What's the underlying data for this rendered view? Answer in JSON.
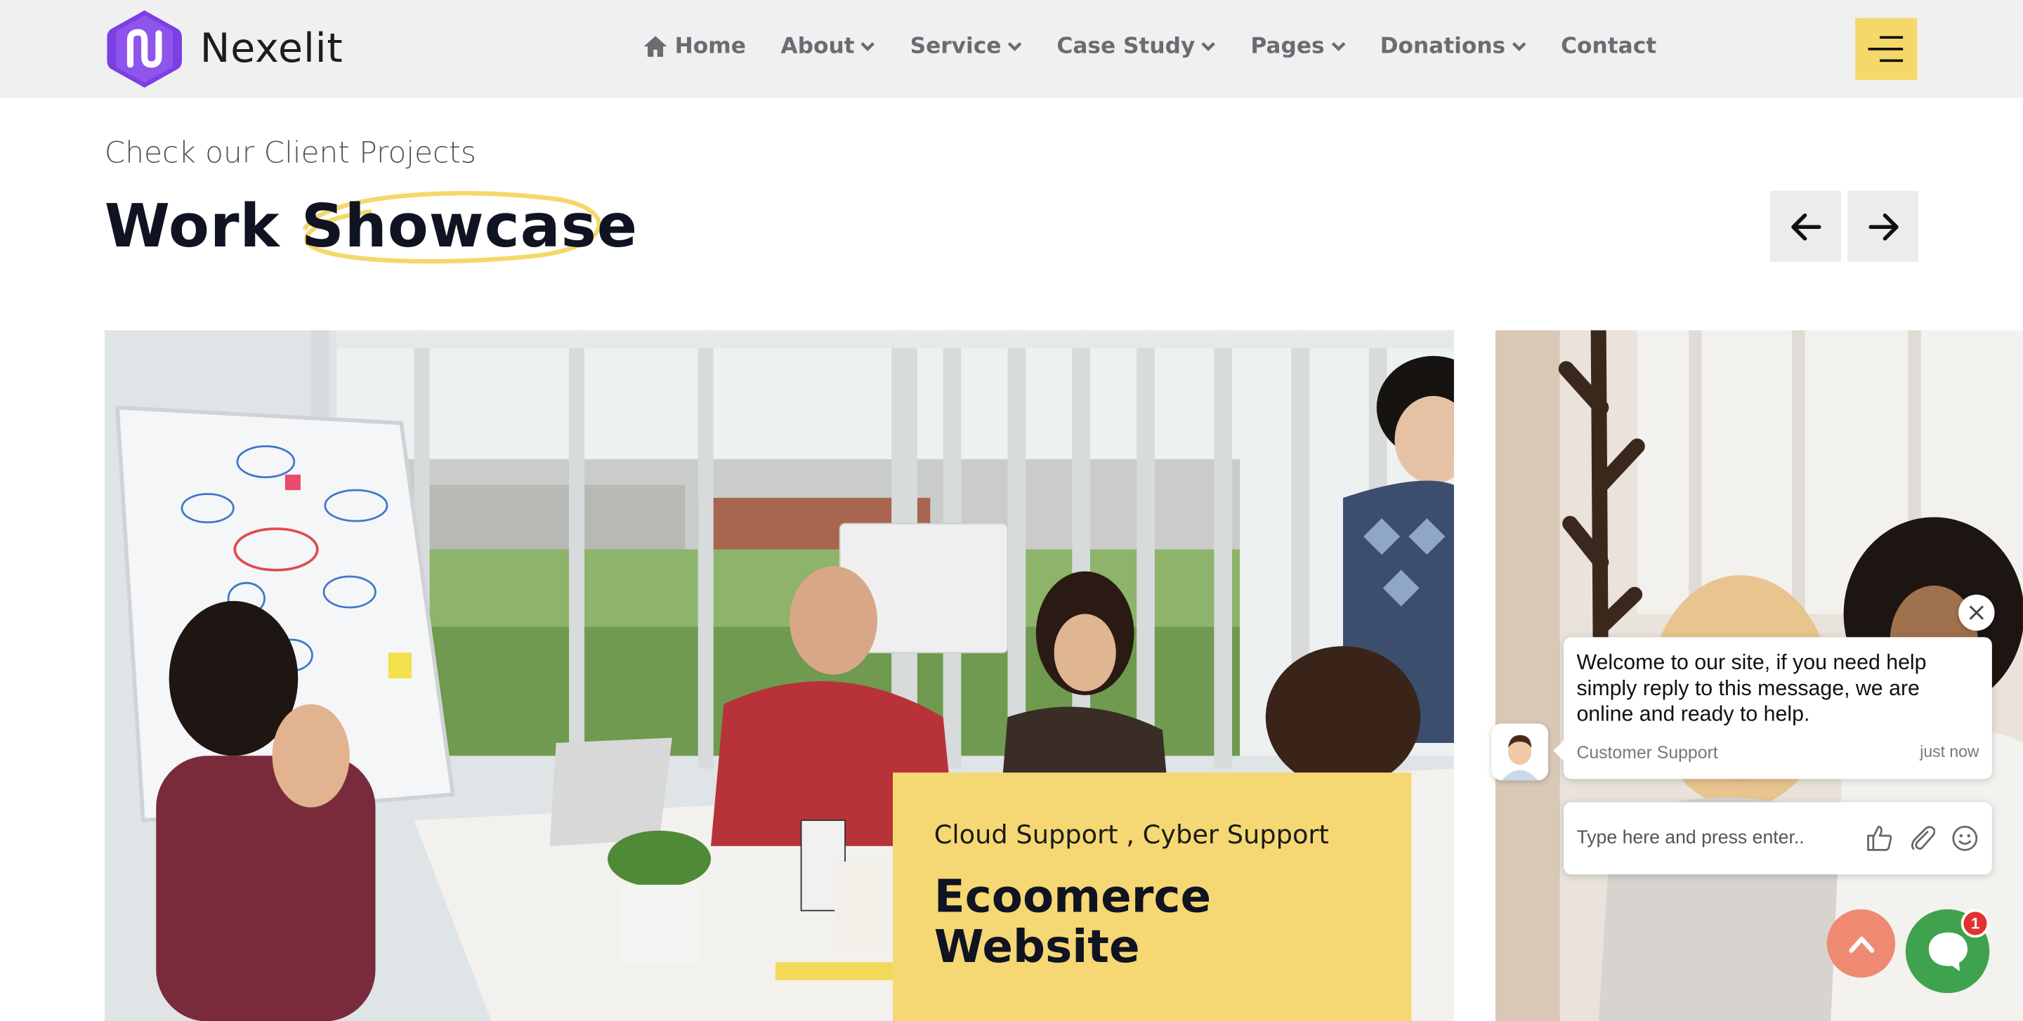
{
  "brand": {
    "name": "Nexelit",
    "logo_color": "#7b3fe4",
    "accent": "#f5d86a"
  },
  "nav": {
    "items": [
      {
        "label": "Home",
        "icon": "home-icon",
        "dropdown": false
      },
      {
        "label": "About",
        "dropdown": true
      },
      {
        "label": "Service",
        "dropdown": true
      },
      {
        "label": "Case Study",
        "dropdown": true
      },
      {
        "label": "Pages",
        "dropdown": true
      },
      {
        "label": "Donations",
        "dropdown": true
      },
      {
        "label": "Contact",
        "dropdown": false
      }
    ],
    "menu_icon": "hamburger-icon"
  },
  "section": {
    "subtitle": "Check our Client Projects",
    "title_plain": "Work ",
    "title_highlight": "Showcase",
    "prev_icon": "arrow-left-icon",
    "next_icon": "arrow-right-icon"
  },
  "projects": [
    {
      "tags": "Cloud Support , Cyber Support",
      "title": "Ecoomerce Website",
      "image": "office-team-meeting-photo"
    },
    {
      "image": "women-meeting-photo"
    }
  ],
  "chat": {
    "message": "Welcome to our site, if you need help simply reply to this message, we are online and ready to help.",
    "sender": "Customer Support",
    "time": "just now",
    "input_placeholder": "Type here and press enter..",
    "unread": "1",
    "launcher_color": "#3fa24f",
    "scroll_top_color": "#ee8a72"
  }
}
